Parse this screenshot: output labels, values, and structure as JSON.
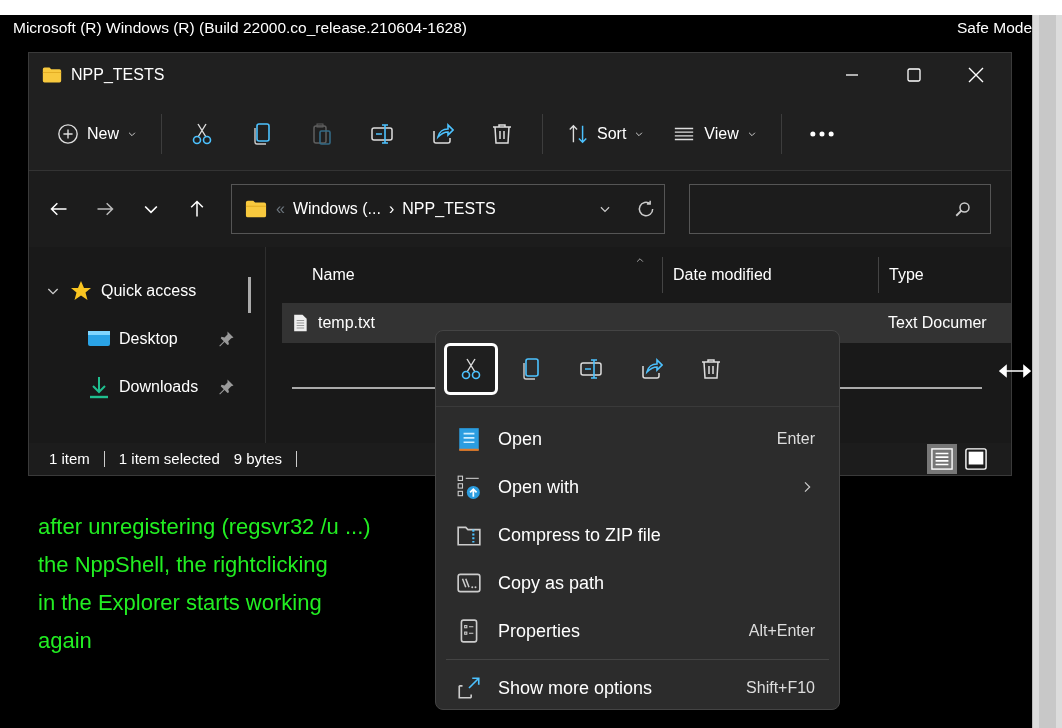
{
  "banner": {
    "title": "Microsoft (R) Windows (R) (Build 22000.co_release.210604-1628)",
    "mode": "Safe Mode"
  },
  "explorer": {
    "title": "NPP_TESTS",
    "toolbar": [
      {
        "kind": "new",
        "label": "New",
        "disabled": false
      },
      {
        "kind": "cut",
        "disabled": false
      },
      {
        "kind": "copy",
        "disabled": false
      },
      {
        "kind": "paste",
        "disabled": true
      },
      {
        "kind": "rename",
        "disabled": false
      },
      {
        "kind": "share",
        "disabled": false
      },
      {
        "kind": "delete",
        "disabled": false
      },
      {
        "kind": "sort",
        "label": "Sort",
        "disabled": false
      },
      {
        "kind": "view",
        "label": "View",
        "disabled": false
      },
      {
        "kind": "more",
        "disabled": false
      }
    ],
    "address": {
      "chevron": "«",
      "crumbs": [
        "Windows (...",
        "NPP_TESTS"
      ],
      "separator": "›"
    },
    "sidebar": [
      {
        "label": "Quick access",
        "kind": "quick",
        "expanded": true,
        "children": [
          {
            "label": "Desktop",
            "kind": "desktop",
            "pinned": true
          },
          {
            "label": "Downloads",
            "kind": "downloads",
            "pinned": true
          }
        ]
      }
    ],
    "columns": [
      "Name",
      "Date modified",
      "Type"
    ],
    "rows": [
      {
        "name": "temp.txt",
        "type": "Text Documer",
        "selected": true
      }
    ],
    "status": [
      "1 item",
      "1 item selected",
      "9 bytes"
    ],
    "views": [
      {
        "kind": "details",
        "selected": true
      },
      {
        "kind": "tiles",
        "selected": false
      }
    ]
  },
  "note": "after unregistering (regsvr32 /u ...)\nthe NppShell, the rightclicking\nin the Explorer starts working\nagain",
  "menu": {
    "actions": [
      {
        "kind": "cut",
        "focused": true
      },
      {
        "kind": "copy",
        "focused": false
      },
      {
        "kind": "rename",
        "focused": false
      },
      {
        "kind": "share",
        "focused": false
      },
      {
        "kind": "delete",
        "focused": false
      }
    ],
    "items": [
      {
        "kind": "open",
        "label": "Open",
        "shortcut": "Enter",
        "submenu": false
      },
      {
        "kind": "openwith",
        "label": "Open with",
        "submenu": true
      },
      {
        "kind": "zip",
        "label": "Compress to ZIP file",
        "submenu": false
      },
      {
        "kind": "path",
        "label": "Copy as path",
        "submenu": false
      },
      {
        "kind": "properties",
        "label": "Properties",
        "shortcut": "Alt+Enter",
        "submenu": false
      }
    ],
    "footer": {
      "kind": "more",
      "label": "Show more options",
      "shortcut": "Shift+F10"
    }
  }
}
